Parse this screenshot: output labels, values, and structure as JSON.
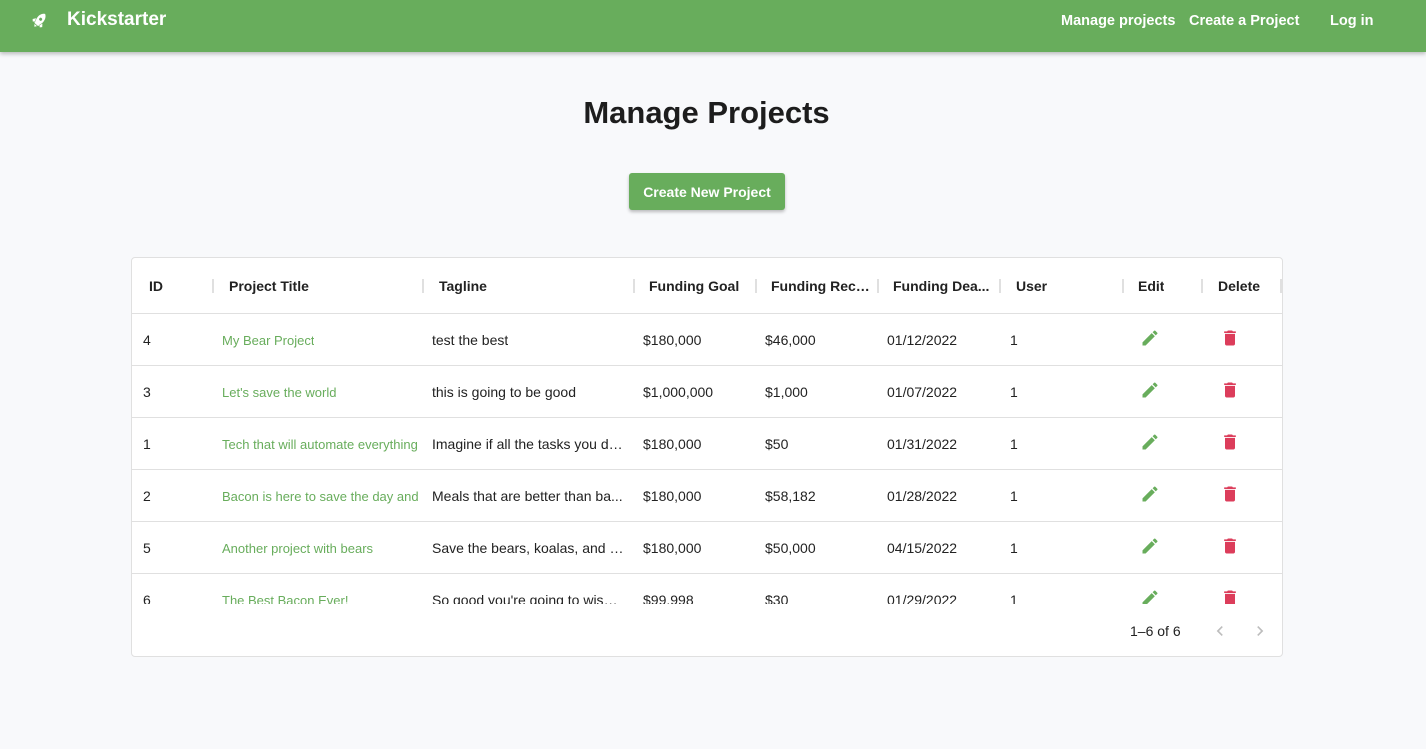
{
  "nav": {
    "brand": "Kickstarter",
    "links": [
      "Manage projects",
      "Create a Project",
      "Log in"
    ],
    "color": "#68ad5c"
  },
  "page": {
    "title": "Manage Projects",
    "create_button": "Create New Project"
  },
  "table": {
    "columns": [
      "ID",
      "Project Title",
      "Tagline",
      "Funding Goal",
      "Funding Rece...",
      "Funding Dea...",
      "User",
      "Edit",
      "Delete"
    ],
    "rows": [
      {
        "id": "4",
        "title": "My Bear Project",
        "tagline": "test the best",
        "goal": "$180,000",
        "received": "$46,000",
        "deadline": "01/12/2022",
        "user": "1"
      },
      {
        "id": "3",
        "title": "Let's save the world",
        "tagline": "this is going to be good",
        "goal": "$1,000,000",
        "received": "$1,000",
        "deadline": "01/07/2022",
        "user": "1"
      },
      {
        "id": "1",
        "title": "Tech that will automate everything",
        "tagline": "Imagine if all the tasks you do...",
        "goal": "$180,000",
        "received": "$50",
        "deadline": "01/31/2022",
        "user": "1"
      },
      {
        "id": "2",
        "title": "Bacon is here to save the day and",
        "tagline": "Meals that are better than ba...",
        "goal": "$180,000",
        "received": "$58,182",
        "deadline": "01/28/2022",
        "user": "1"
      },
      {
        "id": "5",
        "title": "Another project with bears",
        "tagline": "Save the bears, koalas, and pu...",
        "goal": "$180,000",
        "received": "$50,000",
        "deadline": "04/15/2022",
        "user": "1"
      },
      {
        "id": "6",
        "title": "The Best Bacon Ever!",
        "tagline": "So good you're going to wish ...",
        "goal": "$99,998",
        "received": "$30",
        "deadline": "01/29/2022",
        "user": "1"
      }
    ],
    "pagination": "1–6 of 6",
    "edit_color": "#68ad5c",
    "delete_color": "#dc3d5b"
  }
}
